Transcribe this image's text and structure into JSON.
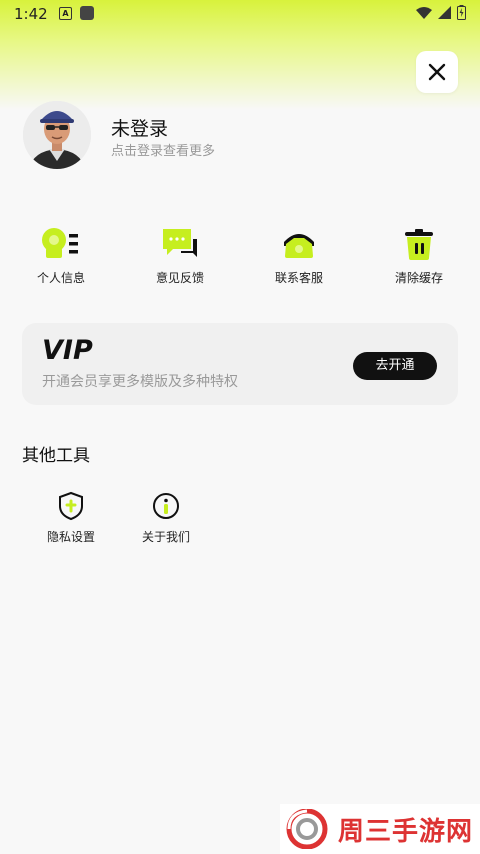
{
  "status_bar": {
    "time": "1:42",
    "notif_letter": "A"
  },
  "profile": {
    "title": "未登录",
    "subtitle": "点击登录查看更多"
  },
  "quick_actions": [
    {
      "label": "个人信息",
      "icon": "profile-info-icon"
    },
    {
      "label": "意见反馈",
      "icon": "feedback-chat-icon"
    },
    {
      "label": "联系客服",
      "icon": "phone-icon"
    },
    {
      "label": "清除缓存",
      "icon": "trash-icon"
    }
  ],
  "vip": {
    "logo": "VIP",
    "description": "开通会员享更多模版及多种特权",
    "button": "去开通"
  },
  "other_tools": {
    "title": "其他工具",
    "items": [
      {
        "label": "隐私设置",
        "icon": "shield-icon"
      },
      {
        "label": "关于我们",
        "icon": "info-icon"
      }
    ]
  },
  "watermark": {
    "text": "周三手游网"
  },
  "colors": {
    "accent": "#d8f23c",
    "dark": "#111111",
    "muted": "#999999"
  }
}
